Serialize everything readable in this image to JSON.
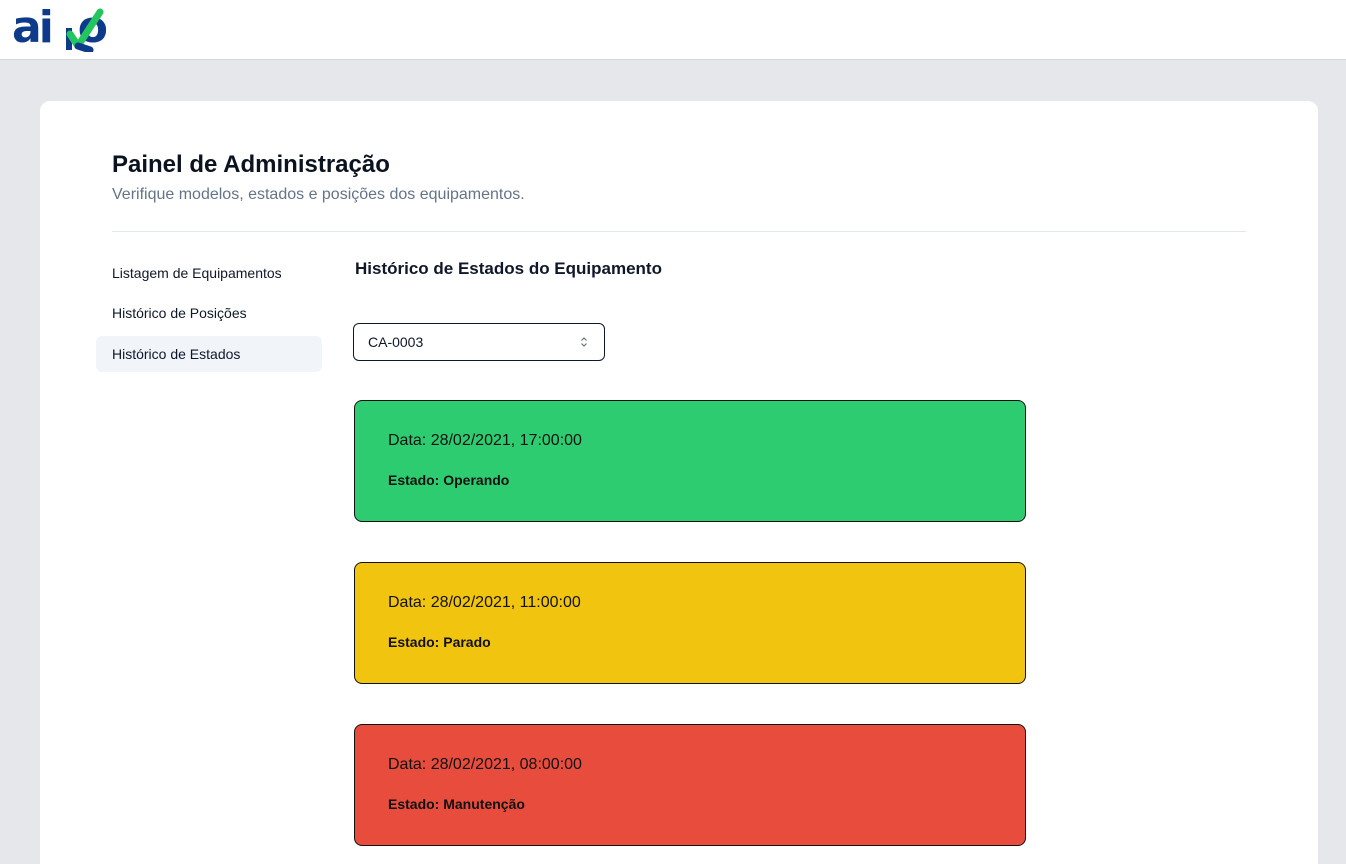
{
  "header": {
    "logo_text": "aiko",
    "logo_letters": [
      "ai",
      "o"
    ]
  },
  "panel": {
    "title": "Painel de Administração",
    "subtitle": "Verifique modelos, estados e posições dos equipamentos."
  },
  "sidebar": {
    "items": [
      {
        "label": "Listagem de Equipamentos",
        "active": false
      },
      {
        "label": "Histórico de Posições",
        "active": false
      },
      {
        "label": "Histórico de Estados",
        "active": true
      }
    ]
  },
  "main": {
    "section_title": "Histórico de Estados do Equipamento",
    "equipment_select": {
      "value": "CA-0003",
      "icon": "chevron-up-down-icon"
    },
    "history": [
      {
        "date_text": "Data: 28/02/2021, 17:00:00",
        "status_text": "Estado: Operando",
        "color": "#2ecc71"
      },
      {
        "date_text": "Data: 28/02/2021, 11:00:00",
        "status_text": "Estado: Parado",
        "color": "#f1c40f"
      },
      {
        "date_text": "Data: 28/02/2021, 08:00:00",
        "status_text": "Estado: Manutenção",
        "color": "#e74c3c"
      }
    ]
  },
  "colors": {
    "logo_blue": "#0d3b8a",
    "logo_check": "#22c55e"
  }
}
